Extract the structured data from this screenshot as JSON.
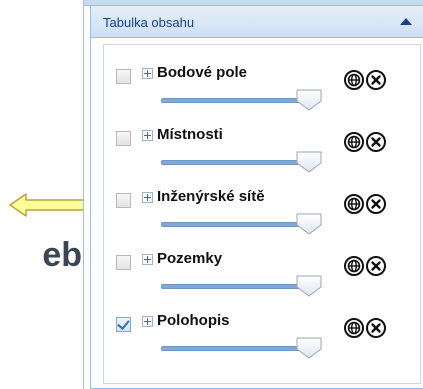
{
  "left": {
    "partial_text": "eb"
  },
  "toc": {
    "title": "Tabulka obsahu",
    "layers": [
      {
        "label": "Bodové pole",
        "visible": false,
        "opacity": 1.0
      },
      {
        "label": "Místnosti",
        "visible": false,
        "opacity": 1.0
      },
      {
        "label": "Inženýrské sítě",
        "visible": false,
        "opacity": 1.0
      },
      {
        "label": "Pozemky",
        "visible": false,
        "opacity": 1.0
      },
      {
        "label": "Polohopis",
        "visible": true,
        "opacity": 1.0
      }
    ]
  },
  "icons": {
    "collapse": "chevron-up-icon",
    "expand": "plus-icon",
    "globe": "globe-icon",
    "remove": "close-icon",
    "pointer": "arrow-left-icon"
  },
  "colors": {
    "header_text": "#15428b",
    "border": "#99bbe8",
    "slider_track": "#7ea9d8",
    "arrow_fill": "#ffff99"
  }
}
